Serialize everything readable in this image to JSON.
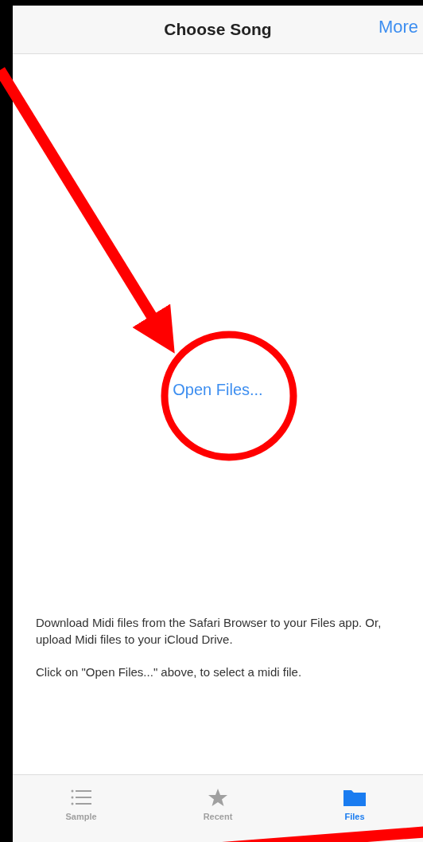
{
  "nav_bar": {
    "title": "Choose Song",
    "right_button": "More"
  },
  "open_files_link": "Open Files...",
  "instructions": [
    "Download Midi files from the Safari Browser to your Files app.  Or, upload Midi files to your iCloud Drive.",
    "Click on \"Open Files...\" above, to select a midi file."
  ],
  "tab_bar": [
    {
      "label": "Sample",
      "selected": false
    },
    {
      "label": "Recent",
      "selected": false
    },
    {
      "label": "Files",
      "selected": true
    }
  ]
}
